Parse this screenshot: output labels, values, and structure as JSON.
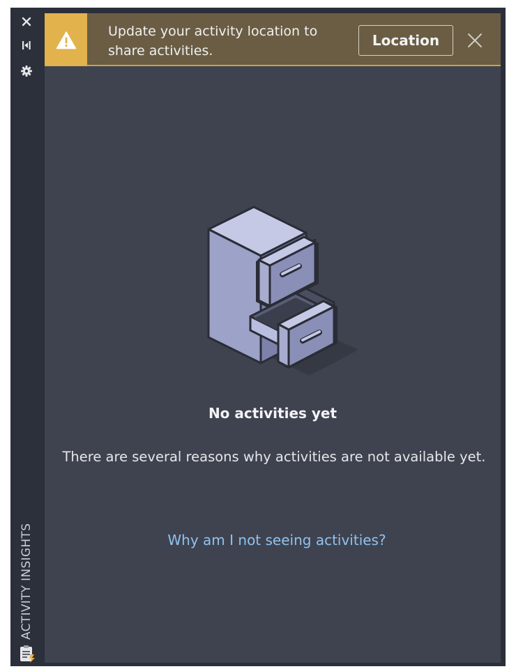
{
  "sidebar": {
    "title": "ACTIVITY INSIGHTS",
    "controls": {
      "close_icon": "close-icon",
      "autohide_icon": "autohide-icon",
      "settings_icon": "gear-icon"
    },
    "bottom_icon": "activity-insights-icon"
  },
  "banner": {
    "icon": "warning-icon",
    "message": "Update your activity location to share activities.",
    "button_label": "Location",
    "close_icon": "close-icon"
  },
  "empty_state": {
    "illustration": "file-cabinet-icon",
    "title": "No activities yet",
    "description": "There are several reasons why activities are not available yet.",
    "link_text": "Why am I not seeing activities?"
  },
  "colors": {
    "panel_background": "#3f4350",
    "banner_background": "#6a5d44",
    "warning_accent": "#e2b24c",
    "link": "#8fc2ee"
  }
}
